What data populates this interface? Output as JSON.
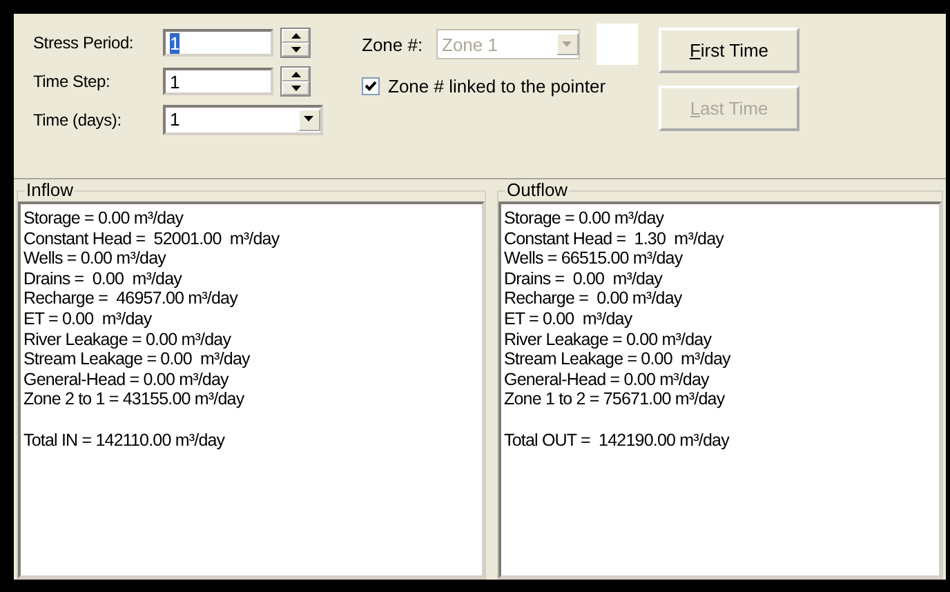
{
  "controls": {
    "stress_period": {
      "label": "Stress Period:",
      "value": "1"
    },
    "time_step": {
      "label": "Time Step:",
      "value": "1"
    },
    "time_days": {
      "label": "Time (days):",
      "value": "1"
    },
    "zone": {
      "label": "Zone #:",
      "value": "Zone 1",
      "disabled": true
    },
    "linked": {
      "label": "Zone # linked to the pointer",
      "checked": true
    },
    "buttons": [
      {
        "label": "First Time",
        "disabled": false
      },
      {
        "label": "Last Time",
        "disabled": true
      }
    ]
  },
  "panels": [
    {
      "title": "Inflow",
      "lines": [
        "Storage = 0.00 m³/day",
        "Constant Head =  52001.00  m³/day",
        "Wells = 0.00 m³/day",
        "Drains =  0.00  m³/day",
        "Recharge =  46957.00 m³/day",
        "ET = 0.00  m³/day",
        "River Leakage = 0.00 m³/day",
        "Stream Leakage = 0.00  m³/day",
        "General-Head = 0.00 m³/day",
        "Zone 2 to 1 = 43155.00 m³/day"
      ],
      "total": "Total IN = 142110.00 m³/day"
    },
    {
      "title": "Outflow",
      "lines": [
        "Storage = 0.00 m³/day",
        "Constant Head =  1.30  m³/day",
        "Wells = 66515.00 m³/day",
        "Drains =  0.00  m³/day",
        "Recharge =  0.00 m³/day",
        "ET = 0.00  m³/day",
        "River Leakage = 0.00 m³/day",
        "Stream Leakage = 0.00  m³/day",
        "General-Head = 0.00 m³/day",
        "Zone 1 to 2 = 75671.00 m³/day"
      ],
      "total": "Total OUT =  142190.00 m³/day"
    }
  ]
}
